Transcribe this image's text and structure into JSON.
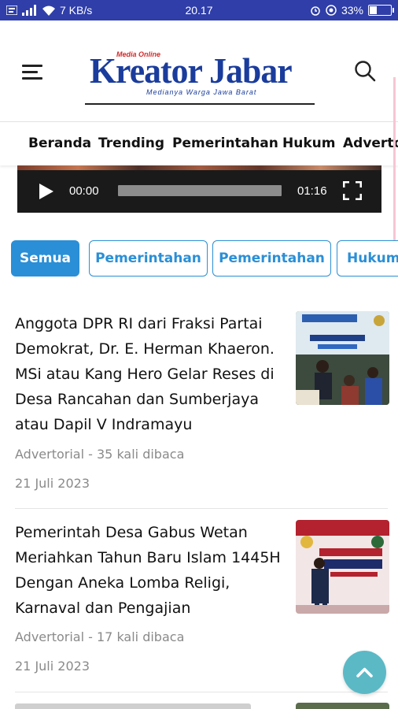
{
  "status_bar": {
    "left_text": "7 KB/s",
    "time": "20.17",
    "battery": "33%",
    "colors": {
      "bg": "#2f3ea8"
    }
  },
  "header": {
    "logo_small": "Media Online",
    "logo_main": "Kreator Jabar",
    "logo_tagline": "Medianya Warga Jawa Barat",
    "icons": [
      "menu-icon",
      "search-icon"
    ]
  },
  "nav": {
    "items": [
      "Beranda",
      "Trending",
      "Pemerintahan",
      "Hukum",
      "Advertorial"
    ]
  },
  "video": {
    "current_time": "00:00",
    "duration": "01:16",
    "progress": 0
  },
  "chips": {
    "items": [
      "Semua",
      "Pemerintahan",
      "Pemerintahan",
      "Hukum"
    ],
    "active_index": 0,
    "accent": "#2a8fd6"
  },
  "articles": [
    {
      "title": "Anggota DPR RI dari Fraksi Partai Demokrat, Dr. E. Herman Khaeron. MSi atau Kang Hero Gelar Reses di  Desa Rancahan dan Sumberjaya atau Dapil V Indramayu",
      "meta": "Advertorial - 35 kali dibaca",
      "date": "21 Juli 2023"
    },
    {
      "title": "Pemerintah Desa Gabus Wetan Meriahkan Tahun Baru Islam 1445H Dengan Aneka Lomba Religi, Karnaval dan Pengajian",
      "meta": "Advertorial - 17 kali dibaca",
      "date": "21 Juli 2023"
    }
  ],
  "back_to_top": {
    "icon": "chevron-up-icon"
  }
}
